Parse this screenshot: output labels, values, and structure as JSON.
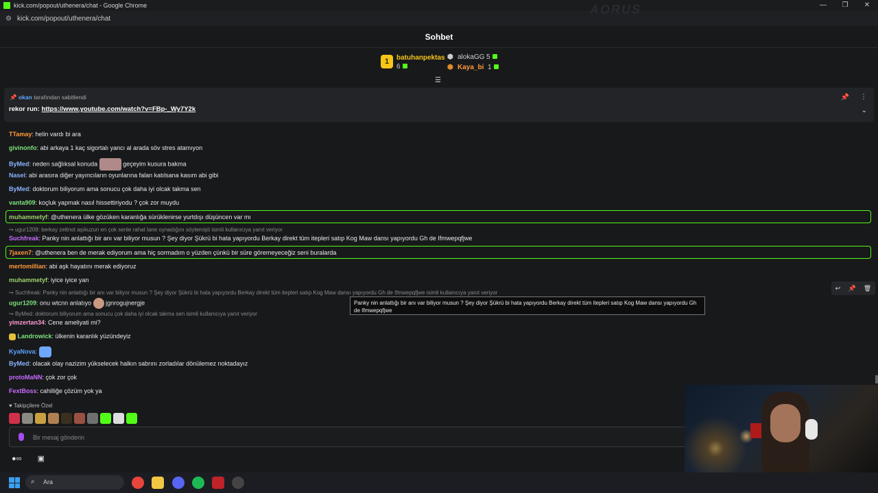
{
  "browser": {
    "title": "kick.com/popout/uthenera/chat - Google Chrome",
    "url": "kick.com/popout/uthenera/chat",
    "watermark": "AORUS"
  },
  "chat": {
    "title": "Sohbet",
    "leaderboard": {
      "first": {
        "rank": "1",
        "name": "batuhanpektas",
        "count": "6"
      },
      "second": {
        "name": "alokaGG",
        "count": "5"
      },
      "third": {
        "name": "Kaya_bi",
        "count": "1"
      }
    },
    "pinned": {
      "by_user": "okan",
      "by_text": "tarafından sabitlendi",
      "prefix": "rekor run:",
      "link": "https://www.youtube.com/watch?v=FBp-_Wy7Y2k"
    },
    "messages": [
      {
        "user": "TTamay",
        "color": "#ff9a3c",
        "text": "helin vardı bi ara"
      },
      {
        "user": "givinonfo",
        "color": "#7be37b",
        "text": "abi arkaya 1 kaç sigortalı yancı al arada söv stres atamıyon"
      },
      {
        "user": "ByMed",
        "color": "#8ab4ff",
        "text": "neden sağlıksal konuda",
        "text2": "geçeyim kusura bakma"
      },
      {
        "user": "Nasei",
        "color": "#8ab4ff",
        "text": "abi arasıra diğer yayıncıların oyunlarına falan katılsana kasım abi gibi"
      },
      {
        "user": "ByMed",
        "color": "#8ab4ff",
        "text": "doktorum biliyorum ama sonucu çok daha iyi olcak takma sen"
      },
      {
        "user": "vanta909",
        "color": "#7be37b",
        "text": "koçluk yapmak nasıl hissettiriyodu ? çok zor muydu"
      },
      {
        "user": "muhammetyf",
        "color": "#9ad36a",
        "text": "@uthenera ülke gözüken karanlığa sürüklenirse yurtdışı düşüncen var mı"
      },
      {
        "reply": "ugur1209: berkay zeltnot aşıkuzun en çok senle rahat lane oynadığını söylemişti isimli kullanıcıya yanıt veriyor"
      },
      {
        "user": "Suchfreak",
        "color": "#c66cff",
        "text": "Panky nin anlattığı bir anı var biliyor musun ? Şey diyor Şükrü bi hata yapıyordu Berkay direkt tüm itepleri satıp Kog Maw dansı yapıyordu Gh de Ifmwepqfjwe"
      },
      {
        "user": "7jaxen7",
        "color": "#ff9a3c",
        "text": "@uthenera ben de merak ediyorum ama hiç sormadım o yüzden çünkü bir süre göremeyeceğiz seni buralarda"
      },
      {
        "user": "mertomillian",
        "color": "#ff9a3c",
        "text": "abi aşk hayatını merak ediyoruz"
      },
      {
        "user": "muhammetyf",
        "color": "#9ad36a",
        "text": "iyice iyice yan"
      },
      {
        "reply": "Suchfreak: Panky nin anlattığı bir anı var biliyor musun ? Şey diyor Şükrü bi hata yapıyordu Berkay direkt tüm itepleri satıp Kog Maw dansı yapıyordu Gh de Ifmwepqfjwe isimli kullanıcıya yanıt veriyor"
      },
      {
        "user": "ugur1209",
        "color": "#7be37b",
        "text": "onu wtcnn anlatıyo",
        "text2": "jgnrogujnergje"
      },
      {
        "reply": "ByMed: doktorum biliyorum ama sonucu çok daha iyi olcak takma sen isimli kullanıcıya yanıt veriyor"
      },
      {
        "user": "yimzertan34",
        "color": "#ff9ad3",
        "text": "Cene ameliyati mi?"
      },
      {
        "user": "Landrowick",
        "color": "#7be37b",
        "text": "ülkenin karanlık yüzündeyiz"
      },
      {
        "user": "KyaNova",
        "color": "#5aa5ff",
        "text": ""
      },
      {
        "user": "ByMed",
        "color": "#8ab4ff",
        "text": "olacak olay nazizim yükselecek halkın sabrını zorladılar dönülemez noktadayız"
      },
      {
        "user": "protoMaNN",
        "color": "#c66cff",
        "text": "çok zor çok"
      },
      {
        "user": "FextBoss",
        "color": "#c66cff",
        "text": "cahilliğe çözüm yok ya"
      }
    ],
    "tooltip": "Panky nin anlattığı bir anı var biliyor musun ? Şey diyor Şükrü bi hata yapıyordu Berkay direkt tüm itepleri satıp Kog Maw dansı yapıyordu Gh de Ifmwepqfjwe",
    "followers_only": "Takipçilere Özel",
    "input_placeholder": "Bir mesaj gönderin"
  },
  "taskbar": {
    "search_placeholder": "Ara"
  }
}
